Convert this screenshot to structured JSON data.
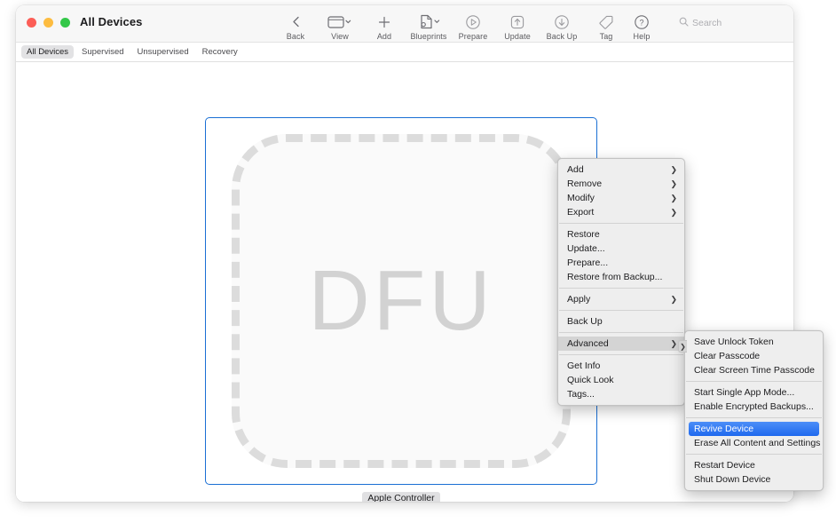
{
  "window": {
    "title": "All Devices",
    "traffic_lights": [
      {
        "name": "close",
        "color": "#fc5e57"
      },
      {
        "name": "minimize",
        "color": "#fdbc40"
      },
      {
        "name": "zoom",
        "color": "#33c748"
      }
    ]
  },
  "toolbar": {
    "items": [
      {
        "label": "Back",
        "icon": "chevron-left-icon",
        "has_caret": false
      },
      {
        "label": "View",
        "icon": "window-icon",
        "has_caret": true
      },
      {
        "label": "Add",
        "icon": "plus-icon",
        "has_caret": false
      },
      {
        "label": "Blueprints",
        "icon": "blueprint-icon",
        "has_caret": true
      },
      {
        "label": "Prepare",
        "icon": "prepare-icon",
        "has_caret": false
      },
      {
        "label": "Update",
        "icon": "update-icon",
        "has_caret": false
      },
      {
        "label": "Back Up",
        "icon": "backup-icon",
        "has_caret": false
      },
      {
        "label": "Tag",
        "icon": "tag-icon",
        "has_caret": false
      }
    ],
    "help": {
      "label": "Help",
      "icon": "help-icon"
    },
    "search": {
      "placeholder": "Search",
      "value": "",
      "icon": "search-icon"
    }
  },
  "filters": {
    "tabs": [
      {
        "label": "All Devices",
        "selected": true
      },
      {
        "label": "Supervised",
        "selected": false
      },
      {
        "label": "Unsupervised",
        "selected": false
      },
      {
        "label": "Recovery",
        "selected": false
      }
    ]
  },
  "device": {
    "state_text": "DFU",
    "name": "Apple Controller",
    "selected": true,
    "selection_color": "#1a6fd4"
  },
  "context_menu": {
    "groups": [
      [
        {
          "label": "Add",
          "submenu": true
        },
        {
          "label": "Remove",
          "submenu": true
        },
        {
          "label": "Modify",
          "submenu": true
        },
        {
          "label": "Export",
          "submenu": true
        }
      ],
      [
        {
          "label": "Restore",
          "submenu": false
        },
        {
          "label": "Update...",
          "submenu": false
        },
        {
          "label": "Prepare...",
          "submenu": false
        },
        {
          "label": "Restore from Backup...",
          "submenu": false
        }
      ],
      [
        {
          "label": "Apply",
          "submenu": true
        }
      ],
      [
        {
          "label": "Back Up",
          "submenu": false
        }
      ],
      [
        {
          "label": "Advanced",
          "submenu": true,
          "hover": true
        }
      ],
      [
        {
          "label": "Get Info",
          "submenu": false
        },
        {
          "label": "Quick Look",
          "submenu": false
        },
        {
          "label": "Tags...",
          "submenu": false
        }
      ]
    ]
  },
  "advanced_submenu": {
    "groups": [
      [
        {
          "label": "Save Unlock Token",
          "active": false
        },
        {
          "label": "Clear Passcode",
          "active": false
        },
        {
          "label": "Clear Screen Time Passcode",
          "active": false
        }
      ],
      [
        {
          "label": "Start Single App Mode...",
          "active": false
        },
        {
          "label": "Enable Encrypted Backups...",
          "active": false
        }
      ],
      [
        {
          "label": "Revive Device",
          "active": true
        },
        {
          "label": "Erase All Content and Settings",
          "active": false
        }
      ],
      [
        {
          "label": "Restart Device",
          "active": false
        },
        {
          "label": "Shut Down Device",
          "active": false
        }
      ]
    ],
    "highlight_color": "#3478f6"
  }
}
